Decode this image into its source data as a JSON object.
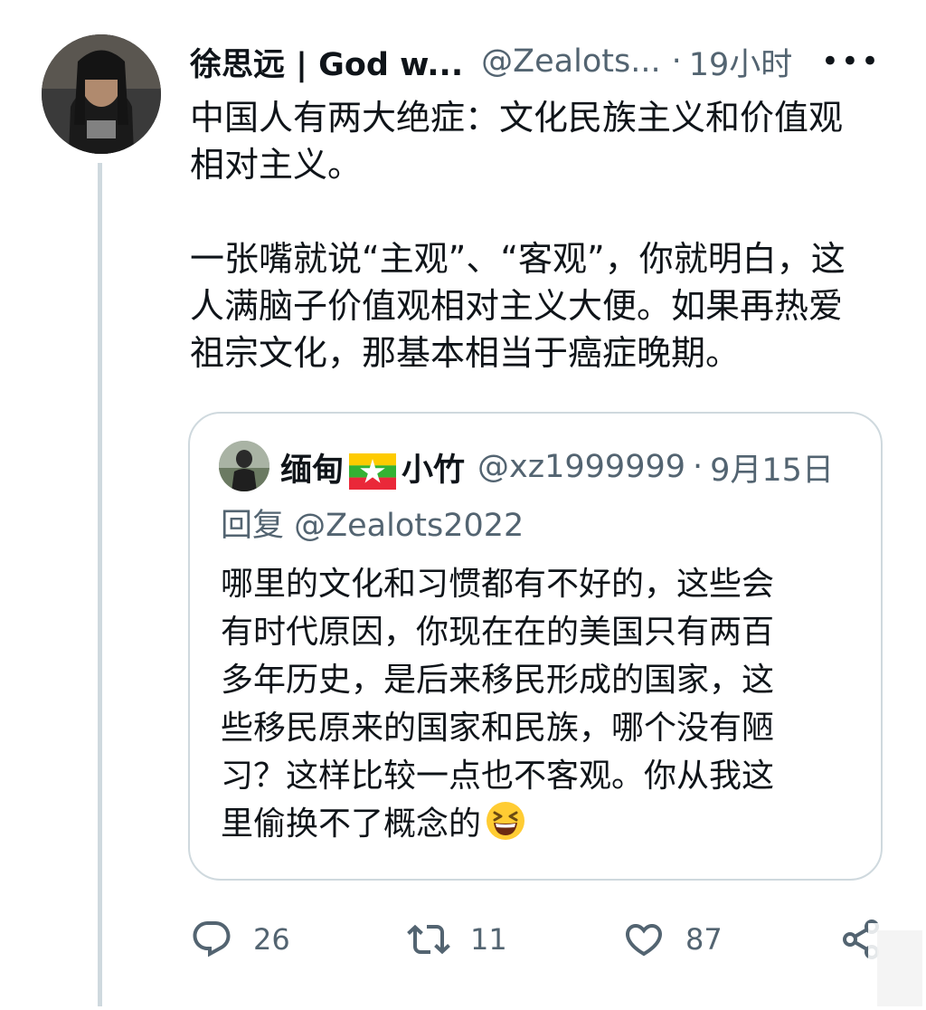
{
  "tweet": {
    "author_name": "徐思远 | God w...",
    "author_handle": "@Zealots...",
    "separator": "·",
    "time": "19小时",
    "more_label": "•••",
    "text_lines": [
      "中国人有两大绝症：文化民族主义和价值观",
      "相对主义。",
      "",
      "一张嘴就说“主观”、“客观”，你就明白，这",
      "人满脑子价值观相对主义大便。如果再热爱",
      "祖宗文化，那基本相当于癌症晚期。"
    ]
  },
  "quote": {
    "author_name_part1": "缅甸",
    "flag_icon": "myanmar-flag",
    "author_name_part2": "小竹",
    "author_handle": "@xz1999999",
    "separator": "·",
    "date": "9月15日",
    "reply_prefix": "回复",
    "reply_to": "@Zealots2022",
    "text_lines": [
      "哪里的文化和习惯都有不好的，这些会",
      "有时代原因，你现在在的美国只有两百",
      "多年历史，是后来移民形成的国家，这",
      "些移民原来的国家和民族，哪个没有陋",
      "习？这样比较一点也不客观。你从我这",
      "里偷换不了概念的"
    ],
    "emoji_icon": "grinning-squinting-face"
  },
  "actions": {
    "reply_count": "26",
    "retweet_count": "11",
    "like_count": "87"
  },
  "colors": {
    "text": "#0f1419",
    "secondary": "#536471",
    "border": "#cfd9de"
  }
}
